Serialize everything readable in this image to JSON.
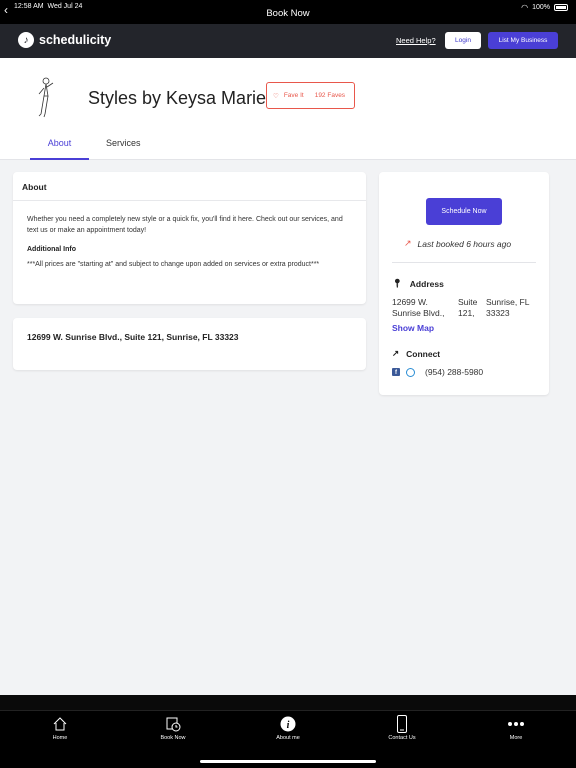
{
  "status_bar": {
    "time": "12:58 AM",
    "date": "Wed Jul 24",
    "title": "Book Now",
    "battery": "100%"
  },
  "topnav": {
    "logo": "schedulicity",
    "need_help": "Need Help?",
    "login": "Login",
    "list_business": "List My Business"
  },
  "business": {
    "name": "Styles by Keysa Marie",
    "fave_label": "Fave It",
    "faves": "192 Faves"
  },
  "tabs": [
    {
      "label": "About"
    },
    {
      "label": "Services"
    }
  ],
  "about": {
    "title": "About",
    "description": "Whether you need a completely new style or a quick fix, you'll find it here. Check out our services, and text us or make an appointment today!",
    "additional_heading": "Additional Info",
    "additional_text": "***All prices are \"starting at\" and subject to change upon added on services or extra product***"
  },
  "address_card": {
    "address": "12699 W. Sunrise Blvd., Suite 121, Sunrise, FL 33323"
  },
  "sidebar": {
    "schedule_now": "Schedule Now",
    "last_booked": "Last booked 6 hours ago",
    "address_heading": "Address",
    "address_col1": "12699 W. Sunrise Blvd.,",
    "address_col2": "Suite 121,",
    "address_col3": "Sunrise, FL 33323",
    "show_map": "Show Map",
    "connect_heading": "Connect",
    "phone": "(954) 288-5980"
  },
  "tabbar": [
    {
      "label": "Home",
      "icon": "home-icon"
    },
    {
      "label": "Book Now",
      "icon": "calendar-clock-icon"
    },
    {
      "label": "About me",
      "icon": "info-icon"
    },
    {
      "label": "Contact Us",
      "icon": "phone-icon"
    },
    {
      "label": "More",
      "icon": "more-icon"
    }
  ],
  "colors": {
    "accent": "#4a3fd6",
    "fave": "#e8574b",
    "nav": "#23252b"
  }
}
